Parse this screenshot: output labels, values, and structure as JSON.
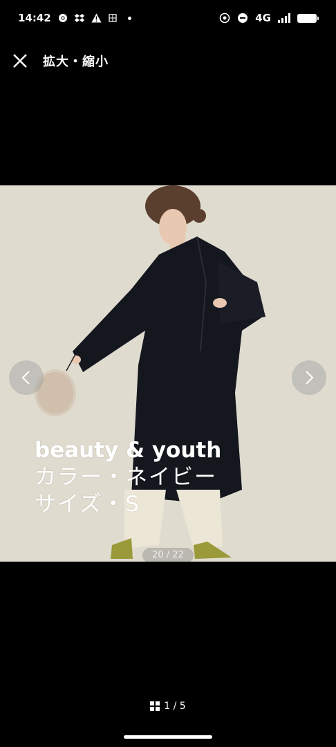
{
  "status_bar": {
    "time": "14:42",
    "left_icons": [
      "chrome-icon",
      "dropbox-icon",
      "warning-icon",
      "sim-icon"
    ],
    "network": "4G",
    "right_icons": [
      "nfc-icon",
      "dnd-icon",
      "signal-icon",
      "battery-icon"
    ]
  },
  "header": {
    "close_icon": "close-icon",
    "title": "拡大・縮小"
  },
  "viewer": {
    "overlay_lines": [
      "beauty & youth",
      "カラー・ネイビー",
      "サイズ・S"
    ],
    "counter": "20 / 22",
    "prev_icon": "chevron-left-icon",
    "next_icon": "chevron-right-icon",
    "background_color": "#e2dfd3"
  },
  "footer": {
    "page_indicator": "1 / 5",
    "grid_icon": "grid-icon"
  }
}
